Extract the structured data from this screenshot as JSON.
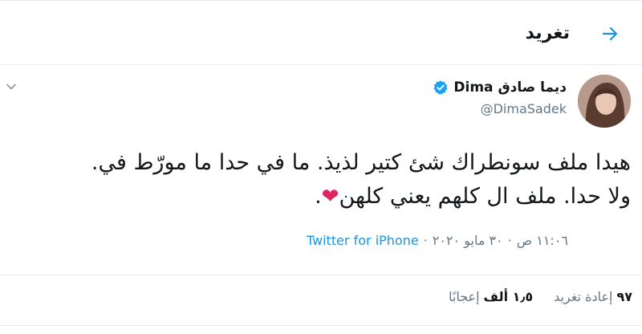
{
  "header": {
    "title": "تغريد"
  },
  "author": {
    "display_name": "ديما صادق Dima",
    "handle": "@DimaSadek"
  },
  "tweet": {
    "line1": "هيدا ملف سونطراك شئ كتير لذيذ. ما في حدا ما مورّط في.",
    "line2_text": "ولا حدا. ملف ال كلهم يعني كلهن",
    "line2_heart": "❤",
    "line2_end": "."
  },
  "meta": {
    "time": "١١:٠٦ ص",
    "separator": "·",
    "date": "٣٠ مايو ٢٠٢٠",
    "source": "Twitter for iPhone"
  },
  "stats": {
    "retweets_count": "٩٧",
    "retweets_label": "إعادة تغريد",
    "likes_count": "١٫٥ ألف",
    "likes_label": "إعجابًا"
  },
  "colors": {
    "accent": "#1b95e0",
    "secondary_text": "#657786",
    "like_red": "#e0245e"
  },
  "icons": {
    "back": "arrow-right-icon",
    "verified": "verified-badge-icon",
    "more": "chevron-down-icon"
  }
}
